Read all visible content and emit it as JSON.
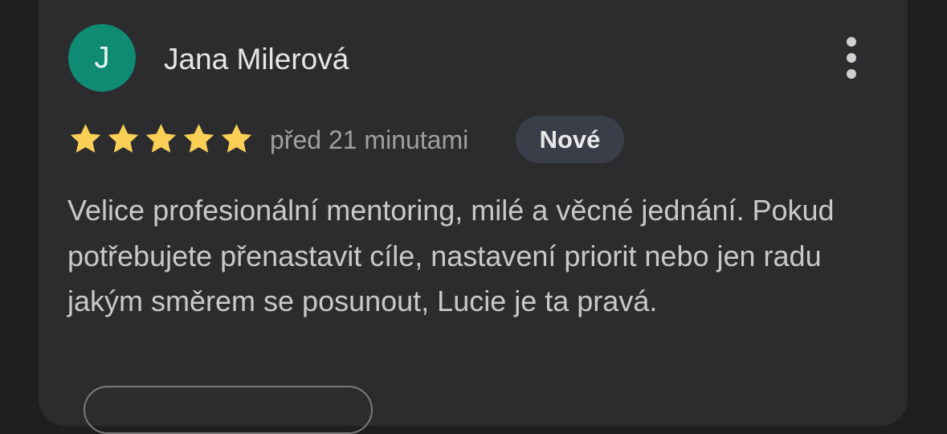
{
  "review": {
    "avatar_letter": "J",
    "avatar_color": "#0f8a73",
    "author_name": "Jana Milerová",
    "menu_icon": "more-vertical-icon",
    "rating": 5,
    "rating_max": 5,
    "star_color": "#f9cf55",
    "time_ago": "před 21 minutami",
    "badge": "Nové",
    "text": "Velice profesionální mentoring, milé a věcné jednání. Pokud potřebujete přenastavit cíle, nastavení priorit nebo jen radu jakým směrem se posunout, Lucie je ta pravá."
  }
}
